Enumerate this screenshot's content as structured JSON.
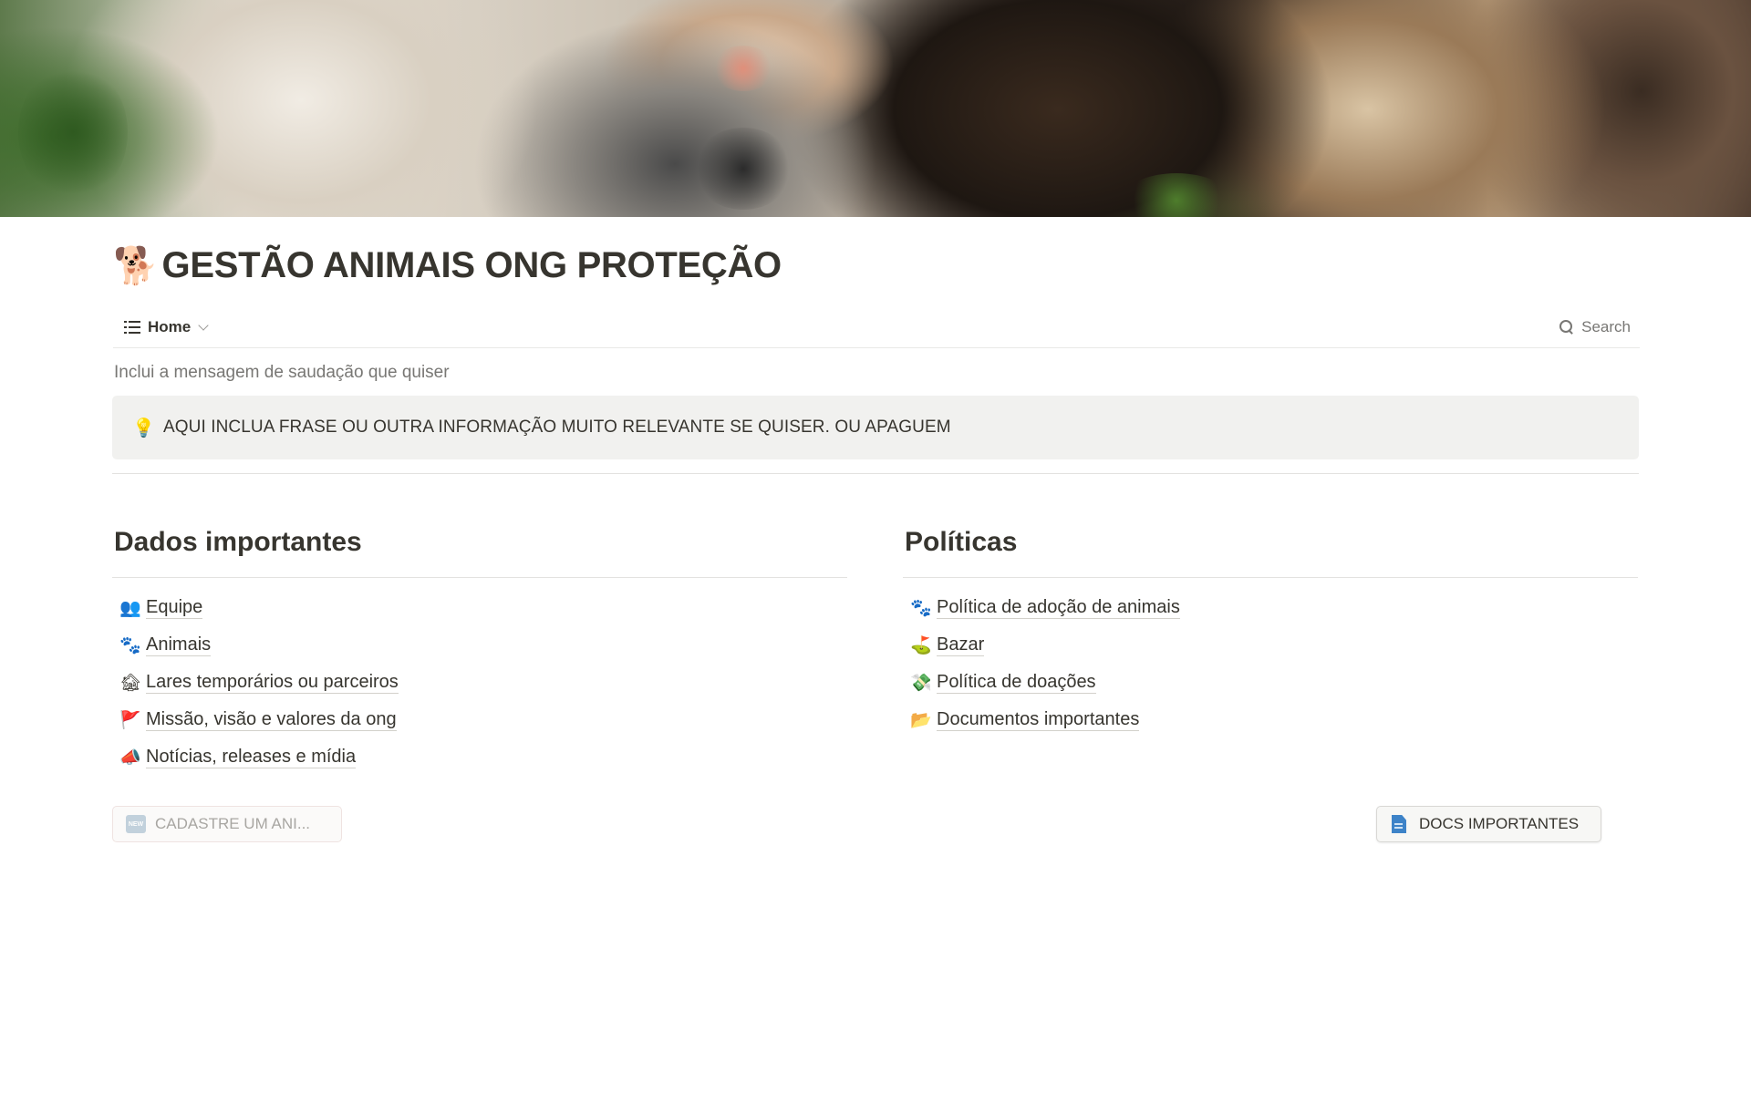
{
  "page": {
    "title_icon": "🐕",
    "title": "GESTÃO ANIMAIS ONG PROTEÇÃO"
  },
  "viewbar": {
    "tab_label": "Home",
    "tab_icon": "list-icon",
    "search_label": "Search"
  },
  "greeting": "Inclui a mensagem de saudação que quiser",
  "callout": {
    "icon": "💡",
    "text": "AQUI INCLUA FRASE OU OUTRA INFORMAÇÃO MUITO RELEVANTE SE QUISER. OU APAGUEM"
  },
  "left_column": {
    "heading": "Dados importantes",
    "items": [
      {
        "icon": "👥",
        "label": "Equipe"
      },
      {
        "icon": "🐾",
        "label": "Animais"
      },
      {
        "icon": "🏚",
        "label": "Lares temporários ou parceiros"
      },
      {
        "icon": "🚩",
        "label": "Missão, visão e valores da ong"
      },
      {
        "icon": "📣",
        "label": "Notícias, releases e mídia"
      }
    ]
  },
  "right_column": {
    "heading": "Políticas",
    "items": [
      {
        "icon": "🐾",
        "label": "Política de adoção de animais"
      },
      {
        "icon": "⛳",
        "label": "Bazar"
      },
      {
        "icon": "💸",
        "label": "Política de doações"
      },
      {
        "icon": "📂",
        "label": "Documentos importantes"
      }
    ]
  },
  "buttons": {
    "cadastre": {
      "icon": "NEW",
      "label": "CADASTRE UM ANI..."
    },
    "docs": {
      "icon": "document-icon",
      "label": "DOCS IMPORTANTES"
    }
  },
  "colors": {
    "text": "#37352f",
    "muted": "#787774",
    "callout_bg": "#f1f1ef",
    "divider": "#e3e2e0"
  }
}
